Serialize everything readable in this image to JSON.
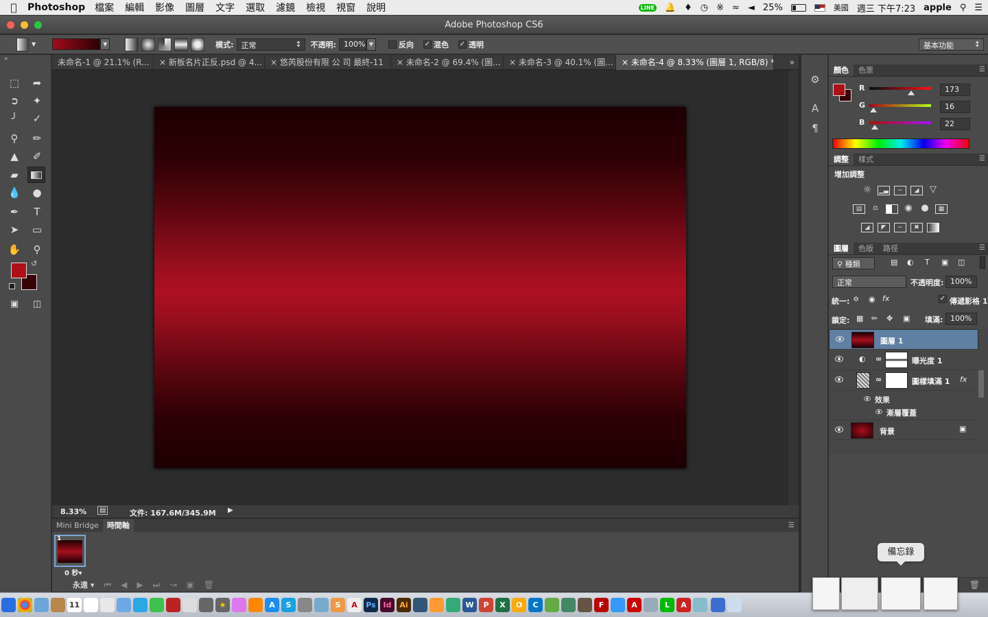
{
  "menubar": {
    "app_name": "Photoshop",
    "menus": [
      "檔案",
      "編輯",
      "影像",
      "圖層",
      "文字",
      "選取",
      "濾鏡",
      "檢視",
      "視窗",
      "說明"
    ],
    "line_badge": "LINE",
    "battery": "25%",
    "input_source": "美國",
    "clock": "週三 下午7:23",
    "user": "apple"
  },
  "window": {
    "title": "Adobe Photoshop CS6",
    "workspace": "基本功能"
  },
  "options": {
    "mode_label": "模式:",
    "mode_value": "正常",
    "opacity_label": "不透明:",
    "opacity_value": "100%",
    "reverse_label": "反向",
    "dither_label": "混色",
    "transparency_label": "透明",
    "gradient_colors": [
      "#a10d1a",
      "#2a0004"
    ]
  },
  "tabs": [
    {
      "label": "未命名-1 @ 21.1% (R..."
    },
    {
      "label": "新板名片正反.psd @ 4..."
    },
    {
      "label": "悠芮股份有限 公 司 最終-11"
    },
    {
      "label": "未命名-2 @ 69.4% (圖..."
    },
    {
      "label": "未命名-3 @ 40.1% (圖..."
    },
    {
      "label": "未命名-4 @ 8.33% (圖層 1, RGB/8) *"
    }
  ],
  "status": {
    "zoom": "8.33%",
    "doc_info": "文件: 167.6M/345.9M"
  },
  "bottom_panel": {
    "tabs": [
      "Mini Bridge",
      "時間軸"
    ],
    "frame_number": "1",
    "frame_delay": "0 秒",
    "loop": "永遠"
  },
  "color_panel": {
    "tabs": [
      "顏色",
      "色票"
    ],
    "r_label": "R",
    "r": "173",
    "g_label": "G",
    "g": "16",
    "b_label": "B",
    "b": "22",
    "foreground": "#ad1016",
    "background": "#350306"
  },
  "adjust_panel": {
    "tabs": [
      "調整",
      "樣式"
    ],
    "heading": "增加調整"
  },
  "layers_panel": {
    "tabs": [
      "圖層",
      "色版",
      "路徑"
    ],
    "filter": "種類",
    "blend": "正常",
    "opacity_label": "不透明度:",
    "opacity": "100%",
    "unify_label": "統一:",
    "propagate_label": "傳遞影格 1",
    "lock_label": "鎖定:",
    "fill_label": "填滿:",
    "fill": "100%",
    "layers": [
      {
        "name": "圖層 1",
        "selected": true
      },
      {
        "name": "曝光度 1"
      },
      {
        "name": "圖樣填滿 1",
        "fx": "fx"
      },
      {
        "name": "效果"
      },
      {
        "name": "漸層覆蓋"
      },
      {
        "name": "背景"
      }
    ]
  },
  "tooltip": "備忘錄",
  "tools": [
    "marquee-tool",
    "move-tool",
    "lasso-tool",
    "magic-wand-tool",
    "crop-tool",
    "eyedropper-tool",
    "healing-tool",
    "brush-tool",
    "stamp-tool",
    "history-brush-tool",
    "eraser-tool",
    "gradient-tool",
    "blur-tool",
    "dodge-tool",
    "pen-tool",
    "type-tool",
    "path-select-tool",
    "shape-tool",
    "hand-tool",
    "zoom-tool"
  ]
}
